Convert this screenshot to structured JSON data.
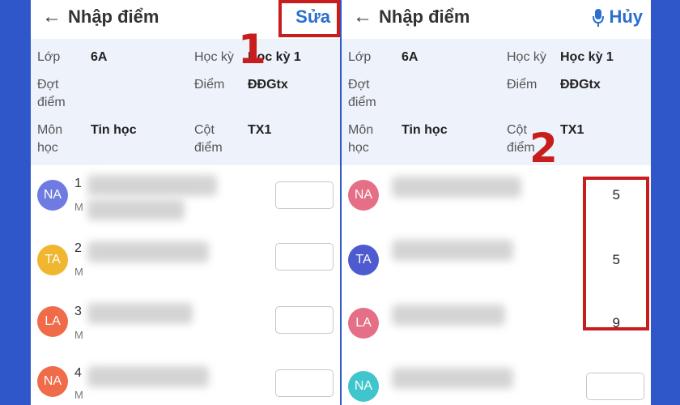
{
  "left": {
    "title": "Nhập điểm",
    "action_label": "Sửa",
    "info": {
      "class_label": "Lớp",
      "class_value": "6A",
      "term_label": "Học kỳ",
      "term_value": "Học kỳ 1",
      "period_label": "Đợt\nđiểm",
      "score_label": "Điểm",
      "score_value": "ĐĐGtx",
      "subject_label": "Môn\nhọc",
      "subject_value": "Tin học",
      "column_label": "Cột\nđiểm",
      "column_value": "TX1"
    },
    "students": [
      {
        "initials": "NA",
        "color": "#6f7be0",
        "num": "1",
        "sub": "M"
      },
      {
        "initials": "TA",
        "color": "#f0b62f",
        "num": "2",
        "sub": "M"
      },
      {
        "initials": "LA",
        "color": "#ef6b4a",
        "num": "3",
        "sub": "M"
      },
      {
        "initials": "NA",
        "color": "#ef6b4a",
        "num": "4",
        "sub": "M"
      }
    ]
  },
  "right": {
    "title": "Nhập điểm",
    "action_label": "Hủy",
    "info": {
      "class_label": "Lớp",
      "class_value": "6A",
      "term_label": "Học kỳ",
      "term_value": "Học kỳ 1",
      "period_label": "Đợt\nđiểm",
      "score_label": "Điểm",
      "score_value": "ĐĐGtx",
      "subject_label": "Môn\nhọc",
      "subject_value": "Tin học",
      "column_label": "Cột\nđiểm",
      "column_value": "TX1"
    },
    "students": [
      {
        "initials": "NA",
        "color": "#e46f86",
        "score": "5"
      },
      {
        "initials": "TA",
        "color": "#4e5ad0",
        "score": "5"
      },
      {
        "initials": "LA",
        "color": "#e46f86",
        "score": "9"
      },
      {
        "initials": "NA",
        "color": "#3fc5cc",
        "score": ""
      }
    ]
  },
  "annotations": {
    "step1": "1",
    "step2": "2"
  },
  "colors": {
    "accent": "#2b6ed0",
    "highlight": "#c81d1d",
    "background": "#2f57c9"
  }
}
